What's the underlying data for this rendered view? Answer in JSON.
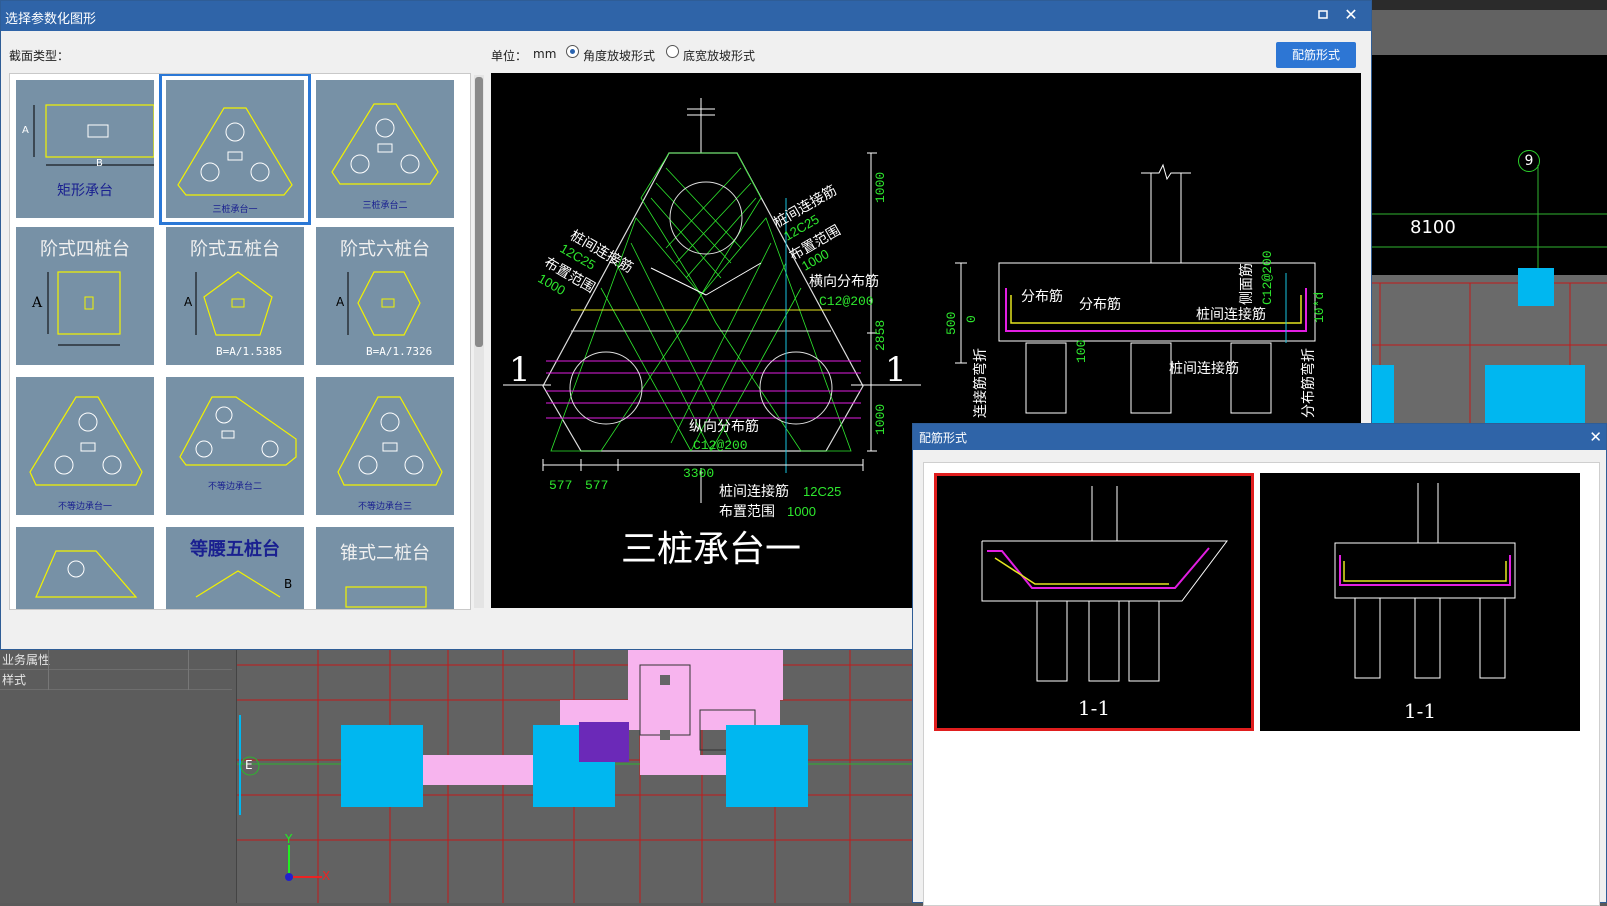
{
  "dialog": {
    "title": "选择参数化图形",
    "section_type_label": "截面类型：",
    "unit_label": "单位：",
    "unit_value": "mm",
    "radio_options": [
      {
        "label": "角度放坡形式",
        "selected": true
      },
      {
        "label": "底宽放坡形式",
        "selected": false
      }
    ],
    "rebar_button": "配筋形式"
  },
  "gallery": {
    "tiles": [
      {
        "name": "矩形承台",
        "label_A": "A",
        "label_B": "B"
      },
      {
        "name": "三桩承台一",
        "selected": true
      },
      {
        "name": "三桩承台二"
      },
      {
        "name": "阶式四桩台",
        "label_A": "A"
      },
      {
        "name": "阶式五桩台",
        "label_A": "A",
        "formula": "B=A/1.5385"
      },
      {
        "name": "阶式六桩台",
        "label_A": "A",
        "formula": "B=A/1.7326"
      },
      {
        "name": "不等边承台一"
      },
      {
        "name": "不等边承台二"
      },
      {
        "name": "不等边承台三"
      },
      {
        "name": ""
      },
      {
        "name": "等腰五桩台",
        "label_B": "B"
      },
      {
        "name": "锥式二桩台"
      }
    ]
  },
  "preview": {
    "title": "三桩承台一",
    "section_mark": "1",
    "annotations": {
      "pile_conn_left": "桩间连接筋",
      "pile_conn_left_spec": "12C25",
      "arrange_left": "布置范围",
      "arrange_left_val": "1000",
      "pile_conn_right": "桩间连接筋",
      "pile_conn_right_spec": "12C25",
      "arrange_right": "布置范围",
      "arrange_right_val": "1000",
      "transverse": "横向分布筋",
      "transverse_spec": "C12@200",
      "longitudinal": "纵向分布筋",
      "longitudinal_spec": "C12@200",
      "bottom_conn": "桩间连接筋",
      "bottom_conn_spec": "12C25",
      "bottom_arrange": "布置范围",
      "bottom_arrange_val": "1000"
    },
    "dims": {
      "v1": "1000",
      "v2": "2858",
      "v3": "1000",
      "h_total": "3300",
      "h1": "577",
      "h2": "577",
      "sec_h": "500",
      "sec_0": "0",
      "sec_100": "100",
      "side_spec": "C12@200"
    },
    "section_labels": {
      "dist1": "分布筋",
      "dist2": "分布筋",
      "pile_conn": "桩间连接筋",
      "pile_conn_bottom": "桩间连接筋",
      "side_face": "侧面筋",
      "bend_left": "连接筋弯折",
      "bend_right": "分布筋弯折",
      "ten_d": "10*d"
    }
  },
  "rebar_dialog": {
    "title": "配筋形式",
    "options": [
      {
        "caption": "1-1",
        "selected": true
      },
      {
        "caption": "1-1",
        "selected": false
      }
    ]
  },
  "background": {
    "props": [
      "业务属性",
      "样式"
    ],
    "axis_label": "9",
    "dim_value": "8100",
    "grid_axis": "E",
    "x_axis": "X",
    "y_axis": "Y"
  },
  "colors": {
    "titlebar": "#2f64a8",
    "button": "#2d76d4",
    "tile_bg": "#7791a6",
    "cyan": "#00b7f0",
    "pink": "#f7b4ee"
  }
}
